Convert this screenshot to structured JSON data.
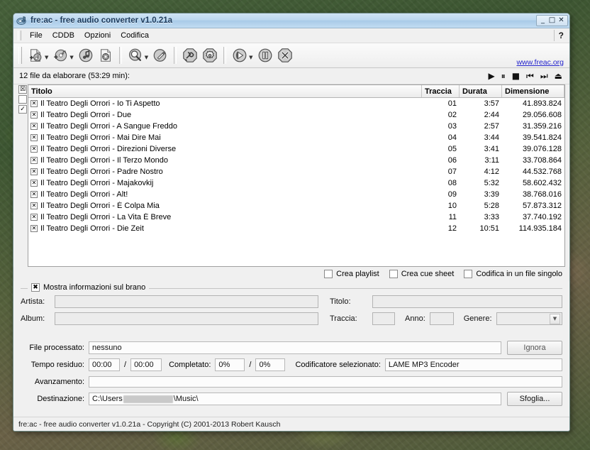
{
  "window": {
    "title": "fre:ac - free audio converter v1.0.21a",
    "icon": "freac-app-icon",
    "buttons": {
      "minimize": "_",
      "maximize": "□",
      "close": "✕"
    }
  },
  "menubar": {
    "items": [
      "File",
      "CDDB",
      "Opzioni",
      "Codifica"
    ],
    "help": "?"
  },
  "toolbar": {
    "buttons": [
      {
        "name": "add-audio-file-button",
        "icon": "add-file-icon",
        "dropdown": true
      },
      {
        "name": "add-audio-cd-button",
        "icon": "add-cd-icon",
        "dropdown": true
      },
      {
        "name": "remove-track-button",
        "icon": "remove-music-icon",
        "dropdown": false
      },
      {
        "name": "clear-joblist-button",
        "icon": "clear-list-icon",
        "dropdown": false
      },
      {
        "name": "load-joblist-button",
        "icon": "open-joblist-icon",
        "dropdown": true
      },
      {
        "name": "save-joblist-button",
        "icon": "save-joblist-icon",
        "dropdown": false
      },
      {
        "name": "general-settings-button",
        "icon": "tools-icon",
        "dropdown": false
      },
      {
        "name": "configure-encoder-button",
        "icon": "gear-icon",
        "dropdown": false
      },
      {
        "name": "start-encoding-button",
        "icon": "play-icon",
        "dropdown": true
      },
      {
        "name": "pause-encoding-button",
        "icon": "pause-icon",
        "dropdown": false
      },
      {
        "name": "stop-encoding-button",
        "icon": "stop-x-icon",
        "dropdown": false
      }
    ],
    "link": "www.freac.org"
  },
  "joblist": {
    "summary": "12 file da elaborare (53:29 min):",
    "check_buttons": [
      {
        "name": "select-all-button",
        "glyph": "☒"
      },
      {
        "name": "select-none-button",
        "glyph": ""
      },
      {
        "name": "toggle-selection-button",
        "glyph": "✓"
      }
    ],
    "player_controls": [
      {
        "name": "play-button",
        "glyph": "▶"
      },
      {
        "name": "pause-button",
        "glyph": "⏸"
      },
      {
        "name": "stop-button",
        "glyph": "■"
      },
      {
        "name": "previous-button",
        "glyph": "⏮"
      },
      {
        "name": "next-button",
        "glyph": "⏭"
      },
      {
        "name": "eject-button",
        "glyph": "⏏"
      }
    ],
    "columns": [
      "Titolo",
      "Traccia",
      "Durata",
      "Dimensione"
    ],
    "rows": [
      {
        "checked": true,
        "title": "Il Teatro Degli Orrori - Io Ti Aspetto",
        "track": "01",
        "duration": "3:57",
        "size": "41.893.824"
      },
      {
        "checked": true,
        "title": "Il Teatro Degli Orrori - Due",
        "track": "02",
        "duration": "2:44",
        "size": "29.056.608"
      },
      {
        "checked": true,
        "title": "Il Teatro Degli Orrori - A Sangue Freddo",
        "track": "03",
        "duration": "2:57",
        "size": "31.359.216"
      },
      {
        "checked": true,
        "title": "Il Teatro Degli Orrori - Mai Dire Mai",
        "track": "04",
        "duration": "3:44",
        "size": "39.541.824"
      },
      {
        "checked": true,
        "title": "Il Teatro Degli Orrori - Direzioni Diverse",
        "track": "05",
        "duration": "3:41",
        "size": "39.076.128"
      },
      {
        "checked": true,
        "title": "Il Teatro Degli Orrori - Il Terzo Mondo",
        "track": "06",
        "duration": "3:11",
        "size": "33.708.864"
      },
      {
        "checked": true,
        "title": "Il Teatro Degli Orrori - Padre Nostro",
        "track": "07",
        "duration": "4:12",
        "size": "44.532.768"
      },
      {
        "checked": true,
        "title": "Il Teatro Degli Orrori - Majakovkij",
        "track": "08",
        "duration": "5:32",
        "size": "58.602.432"
      },
      {
        "checked": true,
        "title": "Il Teatro Degli Orrori - Alt!",
        "track": "09",
        "duration": "3:39",
        "size": "38.768.016"
      },
      {
        "checked": true,
        "title": "Il Teatro Degli Orrori - É Colpa Mia",
        "track": "10",
        "duration": "5:28",
        "size": "57.873.312"
      },
      {
        "checked": true,
        "title": "Il Teatro Degli Orrori - La Vita É Breve",
        "track": "11",
        "duration": "3:33",
        "size": "37.740.192"
      },
      {
        "checked": true,
        "title": "Il Teatro Degli Orrori - Die Zeit",
        "track": "12",
        "duration": "10:51",
        "size": "114.935.184"
      }
    ]
  },
  "options": [
    {
      "label": "Crea playlist",
      "checked": false
    },
    {
      "label": "Crea cue sheet",
      "checked": false
    },
    {
      "label": "Codifica in un file singolo",
      "checked": false
    }
  ],
  "track_info": {
    "group_label": "Mostra informazioni sul brano",
    "group_checked": true,
    "artist_label": "Artista:",
    "artist_value": "",
    "title_label": "Titolo:",
    "title_value": "",
    "album_label": "Album:",
    "album_value": "",
    "track_label": "Traccia:",
    "track_value": "",
    "year_label": "Anno:",
    "year_value": "",
    "genre_label": "Genere:",
    "genre_value": ""
  },
  "status": {
    "file_label": "File processato:",
    "file_value": "nessuno",
    "ignore_button": "Ignora",
    "time_label": "Tempo residuo:",
    "time_current": "00:00",
    "time_sep": "/",
    "time_total": "00:00",
    "completed_label": "Completato:",
    "completed_current": "0%",
    "completed_sep": "/",
    "completed_total": "0%",
    "encoder_label": "Codificatore selezionato:",
    "encoder_value": "LAME MP3 Encoder",
    "progress_label": "Avanzamento:",
    "progress_percent": 0,
    "destination_label": "Destinazione:",
    "destination_prefix": "C:\\Users",
    "destination_suffix": "\\Music\\",
    "browse_button": "Sfoglia..."
  },
  "statusbar": {
    "text": "fre:ac - free audio converter v1.0.21a - Copyright (C) 2001-2013 Robert Kausch"
  },
  "colors": {
    "title_gradient_start": "#cfe3f4",
    "title_text": "#1b3a5c",
    "link": "#2222cc",
    "window_bg": "#f0f0f0",
    "list_bg": "#ffffff"
  }
}
